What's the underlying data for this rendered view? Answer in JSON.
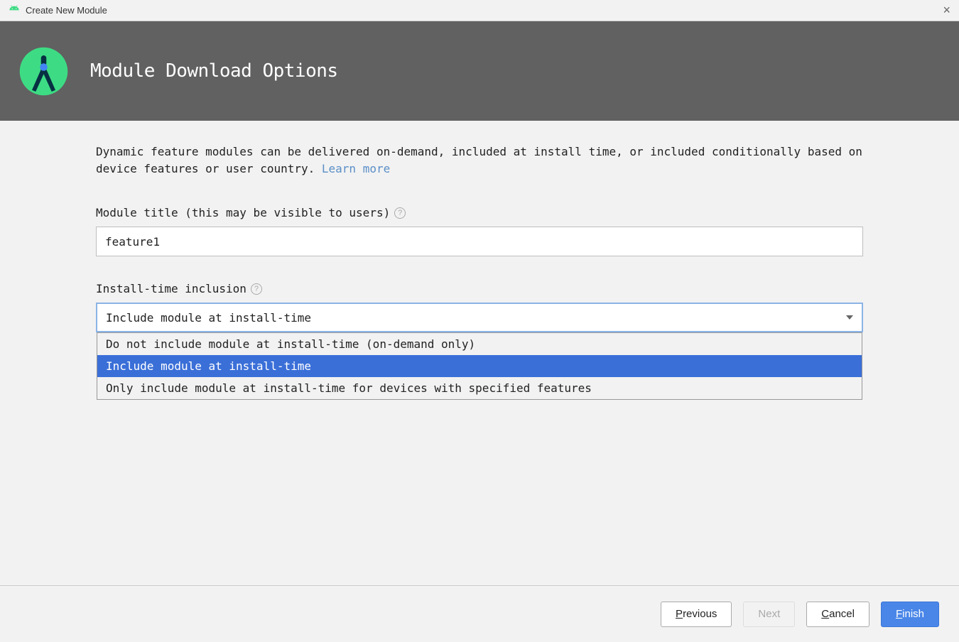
{
  "window": {
    "title": "Create New Module"
  },
  "header": {
    "title": "Module Download Options"
  },
  "content": {
    "description": "Dynamic feature modules can be delivered on-demand, included at install time, or included conditionally based on device features or user country. ",
    "learn_more": "Learn more",
    "module_title": {
      "label": "Module title (this may be visible to users)",
      "value": "feature1"
    },
    "install_inclusion": {
      "label": "Install-time inclusion",
      "selected": "Include module at install-time",
      "options": [
        "Do not include module at install-time (on-demand only)",
        "Include module at install-time",
        "Only include module at install-time for devices with specified features"
      ]
    }
  },
  "footer": {
    "previous": "Previous",
    "next": "Next",
    "cancel": "Cancel",
    "finish": "Finish"
  }
}
